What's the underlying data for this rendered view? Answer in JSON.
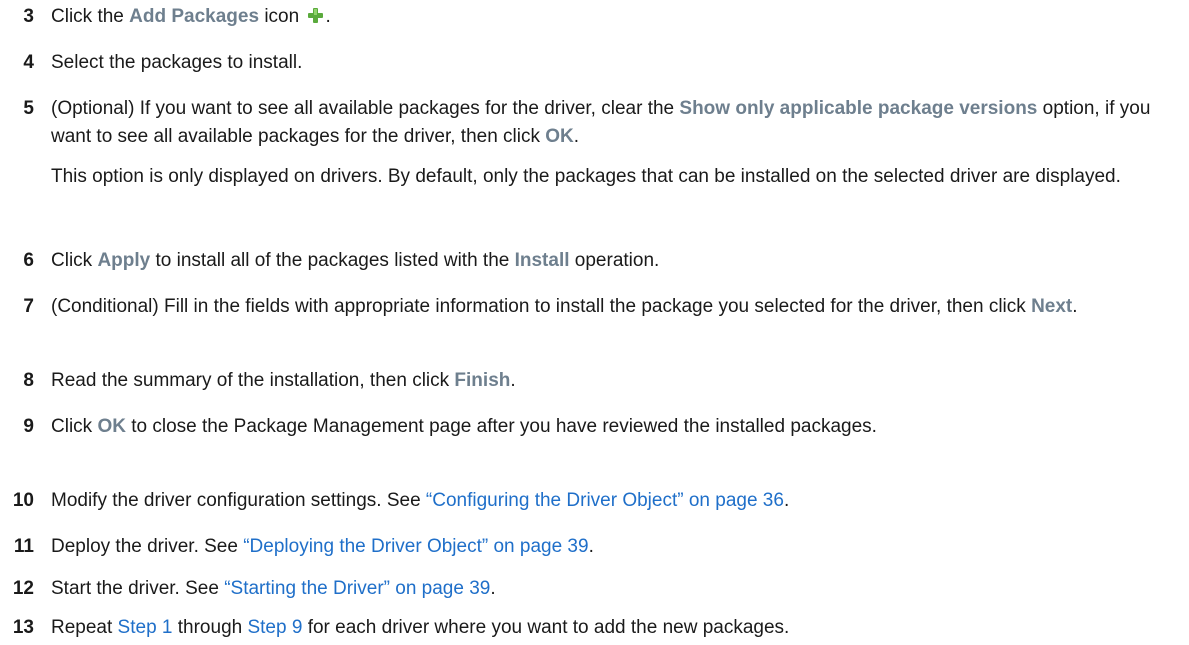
{
  "steps": [
    {
      "num": "3",
      "parts": [
        {
          "t": "Click the "
        },
        {
          "t": "Add Packages",
          "kind": "ui"
        },
        {
          "t": " icon "
        },
        {
          "icon": "plus-icon"
        },
        {
          "t": "."
        }
      ]
    },
    {
      "num": "4",
      "parts": [
        {
          "t": "Select the packages to install."
        }
      ]
    },
    {
      "num": "5",
      "parts": [
        {
          "t": "(Optional) If you want to see all available packages for the driver, clear the "
        },
        {
          "t": "Show only applicable package versions",
          "kind": "ui"
        },
        {
          "t": " option, if you want to see all available packages for the driver, then click "
        },
        {
          "t": "OK",
          "kind": "ui"
        },
        {
          "t": "."
        }
      ],
      "note": "This option is only displayed on drivers. By default, only the packages that can be installed on the selected driver are displayed."
    },
    {
      "num": "6",
      "parts": [
        {
          "t": "Click "
        },
        {
          "t": "Apply",
          "kind": "ui"
        },
        {
          "t": " to install all of the packages listed with the "
        },
        {
          "t": "Install",
          "kind": "ui"
        },
        {
          "t": " operation."
        }
      ]
    },
    {
      "num": "7",
      "parts": [
        {
          "t": "(Conditional) Fill in the fields with appropriate information to install the package you selected for the driver, then click "
        },
        {
          "t": "Next",
          "kind": "ui"
        },
        {
          "t": "."
        }
      ]
    },
    {
      "num": "8",
      "parts": [
        {
          "t": "Read the summary of the installation, then click "
        },
        {
          "t": "Finish",
          "kind": "ui"
        },
        {
          "t": "."
        }
      ]
    },
    {
      "num": "9",
      "parts": [
        {
          "t": "Click "
        },
        {
          "t": "OK",
          "kind": "ui"
        },
        {
          "t": " to close the Package Management page after you have reviewed the installed packages."
        }
      ]
    },
    {
      "num": "10",
      "parts": [
        {
          "t": "Modify the driver configuration settings. See "
        },
        {
          "t": "“Configuring the Driver Object” on page 36",
          "kind": "link"
        },
        {
          "t": "."
        }
      ]
    },
    {
      "num": "11",
      "parts": [
        {
          "t": "Deploy the driver. See "
        },
        {
          "t": "“Deploying the Driver Object” on page 39",
          "kind": "link"
        },
        {
          "t": "."
        }
      ]
    },
    {
      "num": "12",
      "parts": [
        {
          "t": "Start the driver. See "
        },
        {
          "t": "“Starting the Driver” on page 39",
          "kind": "link"
        },
        {
          "t": "."
        }
      ]
    },
    {
      "num": "13",
      "parts": [
        {
          "t": "Repeat "
        },
        {
          "t": "Step 1",
          "kind": "link"
        },
        {
          "t": " through "
        },
        {
          "t": "Step 9",
          "kind": "link"
        },
        {
          "t": " for each driver where you want to add the new packages."
        }
      ]
    }
  ],
  "colors": {
    "ui_label": "#6e7f8e",
    "link": "#1f6fc9",
    "plus_icon": "#5aaa3c"
  }
}
